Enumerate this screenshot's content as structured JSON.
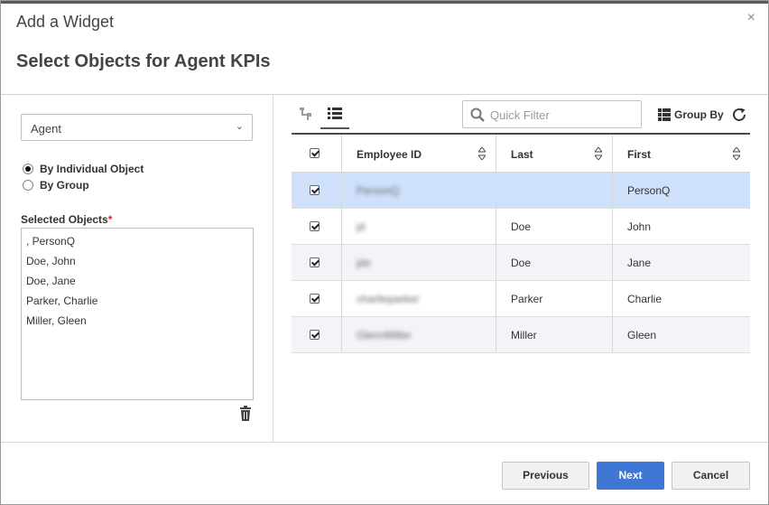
{
  "dialog": {
    "title": "Add a Widget",
    "subtitle": "Select Objects for Agent KPIs",
    "close_glyph": "×"
  },
  "left": {
    "object_type": "Agent",
    "radio_by_individual": "By Individual Object",
    "radio_by_group": "By Group",
    "radio_selected": "By Individual Object",
    "selected_label": "Selected Objects",
    "required_mark": "*",
    "selected_objects": [
      ", PersonQ",
      "Doe, John",
      "Doe, Jane",
      "Parker, Charlie",
      "Miller, Gleen"
    ]
  },
  "toolbar": {
    "quick_filter_placeholder": "Quick Filter",
    "group_by_label": "Group By",
    "icons": [
      "tree-view-icon",
      "list-view-icon",
      "search-icon",
      "grid-icon",
      "refresh-icon"
    ]
  },
  "grid": {
    "columns": [
      "Employee ID",
      "Last",
      "First"
    ],
    "rows": [
      {
        "employee_id": "PersonQ",
        "last": "",
        "first": "PersonQ",
        "checked": true,
        "selected": true
      },
      {
        "employee_id": "jd",
        "last": "Doe",
        "first": "John",
        "checked": true,
        "selected": false
      },
      {
        "employee_id": "jde",
        "last": "Doe",
        "first": "Jane",
        "checked": true,
        "selected": false
      },
      {
        "employee_id": "charlieparker",
        "last": "Parker",
        "first": "Charlie",
        "checked": true,
        "selected": false
      },
      {
        "employee_id": "GlennMiller",
        "last": "Miller",
        "first": "Gleen",
        "checked": true,
        "selected": false
      }
    ]
  },
  "footer": {
    "previous_label": "Previous",
    "next_label": "Next",
    "cancel_label": "Cancel"
  },
  "colors": {
    "accent": "#3f77d4",
    "selected_row": "#cfe0fb",
    "alt_row": "#f3f4f7",
    "required": "#d9262b"
  }
}
